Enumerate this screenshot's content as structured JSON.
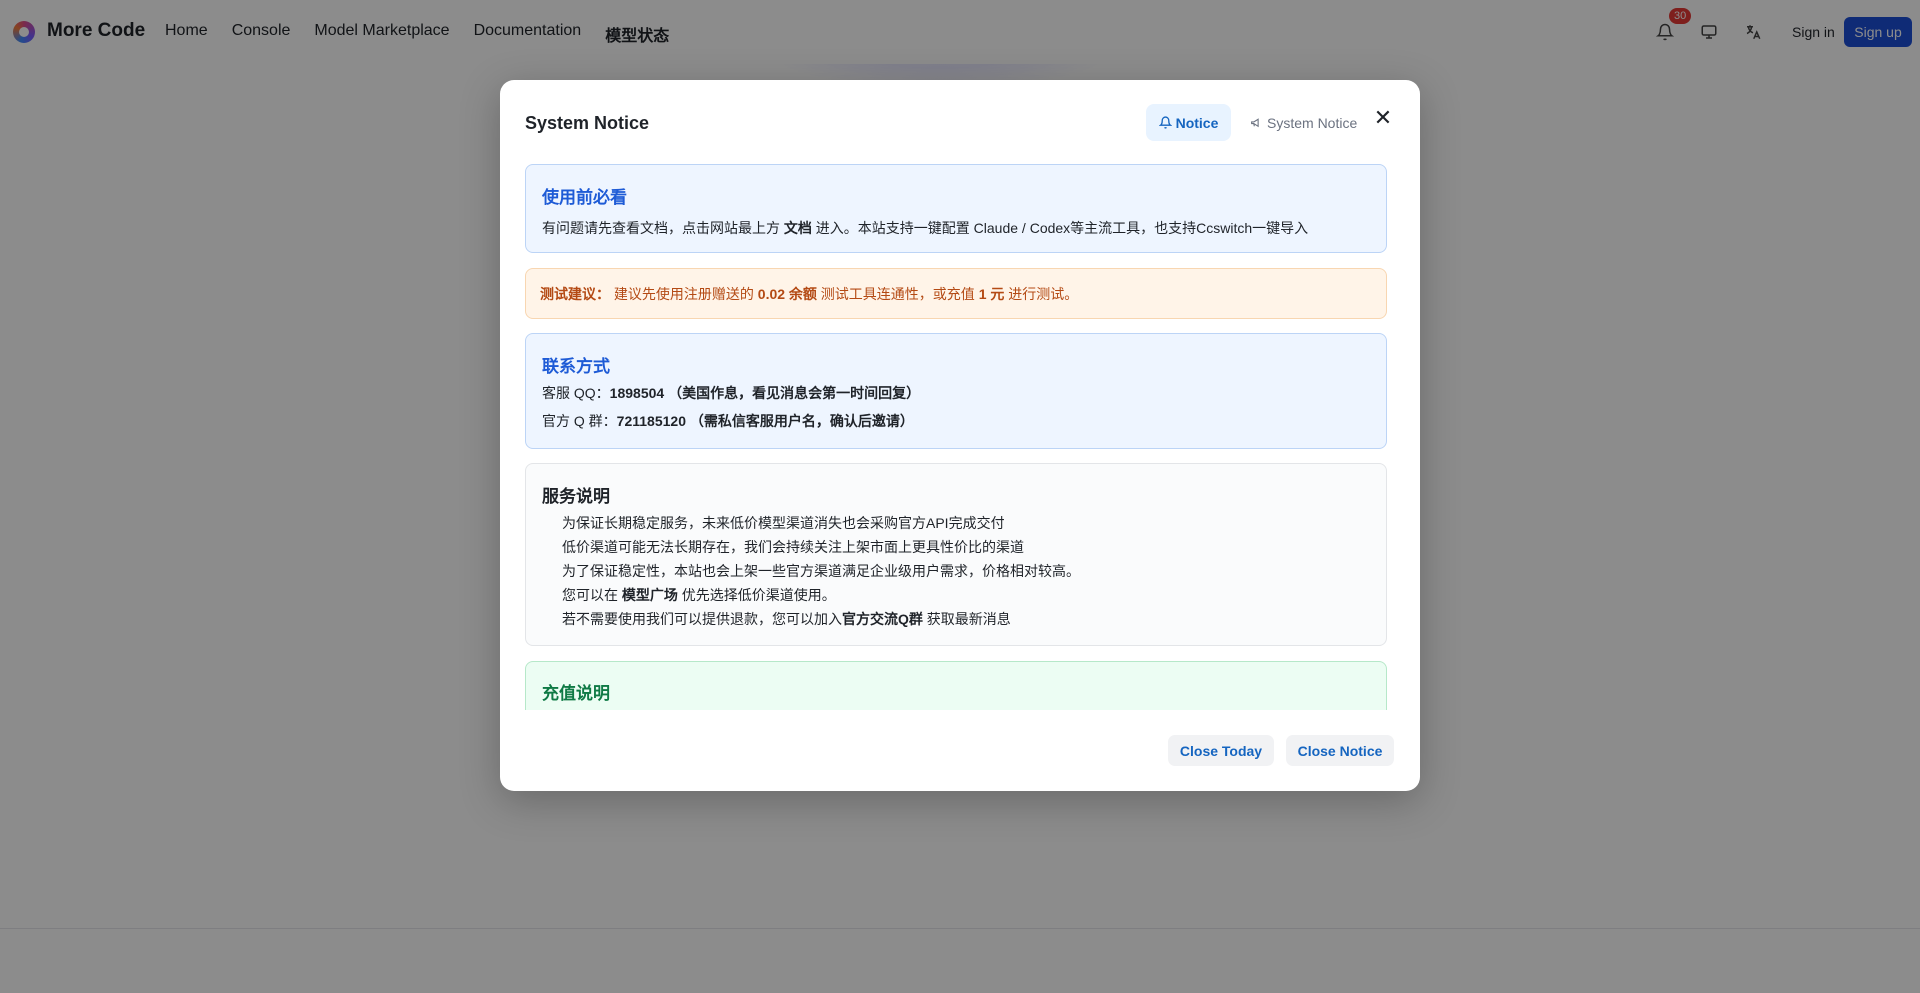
{
  "header": {
    "brand": "More Code",
    "nav": [
      "Home",
      "Console",
      "Model Marketplace",
      "Documentation",
      "模型状态"
    ],
    "notification_count": "30",
    "icons": [
      "bell-icon",
      "monitor-icon",
      "translate-icon"
    ],
    "sign_in": "Sign in",
    "sign_up": "Sign up"
  },
  "modal": {
    "title": "System Notice",
    "tabs": {
      "notice": "Notice",
      "system_notice": "System Notice"
    },
    "cards": {
      "usage": {
        "title": "使用前必看",
        "text_a": "有问题请先查看文档，点击网站最上方 ",
        "text_b": "文档",
        "text_c": " 进入。本站支持一键配置 Claude / Codex等主流工具，也支持Ccswitch一键导入"
      },
      "test": {
        "label": "测试建议：",
        "text_a": " 建议先使用注册赠送的 ",
        "text_b": "0.02 余额",
        "text_c": " 测试工具连通性，或充值 ",
        "text_d": "1 元",
        "text_e": " 进行测试。"
      },
      "contact": {
        "title": "联系方式",
        "qq_label": "客服 QQ：",
        "qq_value": "1898504 （美国作息，看见消息会第一时间回复）",
        "group_label": "官方 Q 群：",
        "group_value": "721185120 （需私信客服用户名，确认后邀请）"
      },
      "service": {
        "title": "服务说明",
        "line1": "为保证长期稳定服务，未来低价模型渠道消失也会采购官方API完成交付",
        "line2": "低价渠道可能无法长期存在，我们会持续关注上架市面上更具性价比的渠道",
        "line3": "为了保证稳定性，本站也会上架一些官方渠道满足企业级用户需求，价格相对较高。",
        "line4_a": "您可以在 ",
        "line4_b": "模型广场",
        "line4_c": " 优先选择低价渠道使用。",
        "line5_a": "若不需要使用我们可以提供退款，您可以加入",
        "line5_b": "官方交流Q群",
        "line5_c": " 获取最新消息"
      },
      "recharge": {
        "title": "充值说明"
      }
    },
    "buttons": {
      "close_today": "Close Today",
      "close_notice": "Close Notice"
    }
  }
}
